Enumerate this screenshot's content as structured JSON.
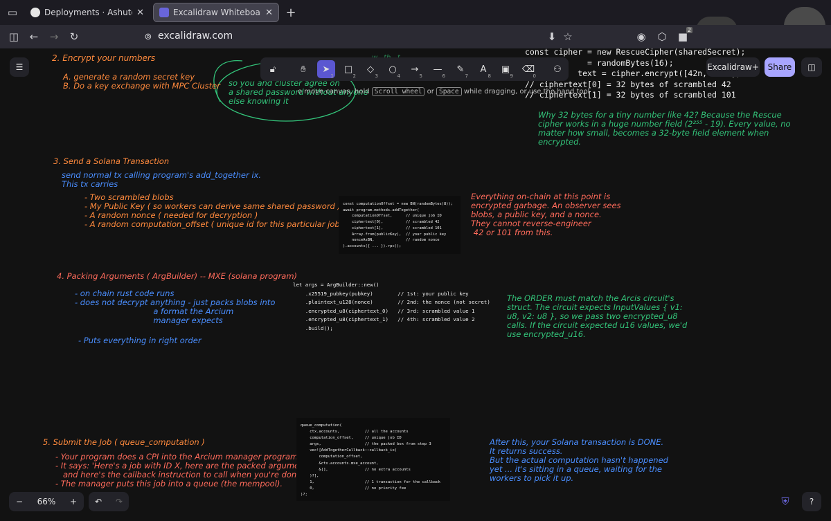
{
  "tabs": [
    {
      "label": "Deployments · Ashutoshx7/Portf",
      "icon": "github-icon"
    },
    {
      "label": "Excalidraw Whiteboard",
      "icon": "excalidraw-icon"
    }
  ],
  "nav": {
    "url": "excalidraw.com",
    "extension_badge": "2"
  },
  "toolbar": {
    "tools": [
      {
        "name": "lock",
        "key": ""
      },
      {
        "name": "hand",
        "key": ""
      },
      {
        "name": "selection",
        "key": "1"
      },
      {
        "name": "rectangle",
        "key": "2"
      },
      {
        "name": "diamond",
        "key": "3"
      },
      {
        "name": "ellipse",
        "key": "4"
      },
      {
        "name": "arrow",
        "key": "5"
      },
      {
        "name": "line",
        "key": "6"
      },
      {
        "name": "draw",
        "key": "7"
      },
      {
        "name": "text",
        "key": "8"
      },
      {
        "name": "image",
        "key": "9"
      },
      {
        "name": "eraser",
        "key": "0"
      },
      {
        "name": "more-tools",
        "key": ""
      }
    ],
    "hint_a": "o move canvas, hold",
    "hint_key1": "Scroll wheel",
    "hint_or": "or",
    "hint_key2": "Space",
    "hint_b": "while dragging, or use the hand tool"
  },
  "top_right": {
    "plus_label": "Excalidraw+",
    "share_label": "Share"
  },
  "zoom": {
    "value": "66%",
    "minus": "−",
    "plus": "+"
  },
  "canvas": {
    "s2_title": "2. Encrypt your numbers",
    "s2_a": "A. generate a random secret key",
    "s2_b": "B. Do a key exchange with MPC Cluster",
    "s2_cut": "w...th...t.  ...  ...   .........  .....",
    "s2_green": "so you and cluster agree on\na shared password without anyone\nelse knowing it",
    "code_top": "const cipher = new RescueCipher(sharedSecret);\n             = randomBytes(16);\n           text = cipher.encrypt([42n, 101n],\n// ciphertext[0] = 32 bytes of scrambled 42\n// ciphertext[1] = 32 bytes of scrambled 101",
    "note_green": "Why 32 bytes for a tiny number like 42? Because the Rescue\ncipher works in a huge number field (2²⁵⁵ - 19). Every value, no\nmatter how small, becomes a 32-byte field element when\nencrypted.",
    "s3_title": "3. Send a Solana Transaction",
    "s3_lines": "send normal tx calling program's add_together ix.\nThis tx carries",
    "s3_list": "- Two scrambled blobs\n- My Public Key ( so workers can derive same shared password ).\n- A random nonce ( needed for decryption )\n- A random computation_offset ( unique id for this particular job )",
    "code_s3": "const computationOffset = new BN(randomBytes(8));\nawait program.methods.addTogether(\n    computationOffset,      // unique job ID\n    ciphertext[0],          // scrambled 42\n    ciphertext[1],          // scrambled 101\n    Array.from(publicKey),  // your public key\n    nonceAsBN,              // random nonce\n).accounts({ ... }).rpc();",
    "note_red": "Everything on-chain at this point is\nencrypted garbage. An observer sees\nblobs, a public key, and a nonce.\nThey cannot reverse-engineer\n 42 or 101 from this.",
    "s4_title": "4. Packing Arguments ( ArgBuilder) -- MXE (solana program)",
    "s4_lines": "- on chain rust code runs\n- does not decrypt anything - just packs blobs into\n                               a format the Arcium\n                               manager expects",
    "s4_last": "- Puts everything in right order",
    "code_s4": "let args = ArgBuilder::new()\n    .x25519_pubkey(pubkey)        // 1st: your public key\n    .plaintext_u128(nonce)        // 2nd: the nonce (not secret)\n    .encrypted_u8(ciphertext_0)   // 3rd: scrambled value 1\n    .encrypted_u8(ciphertext_1)   // 4th: scrambled value 2\n    .build();",
    "note_green2": "The ORDER must match the Arcis circuit's\nstruct. The circuit expects InputValues { v1:\nu8, v2: u8 }, so we pass two encrypted_u8\ncalls. If the circuit expected u16 values, we'd\nuse encrypted_u16.",
    "s5_title": "5. Submit the Job ( queue_computation )",
    "s5_lines": "- Your program does a CPI into the Arcium manager program.\n- It says: 'Here's a job with ID X, here are the packed arguments,\n   and here's the callback instruction to call when you're done.'\n- The manager puts this job into a queue (the mempool).",
    "code_s5": "queue_computation(\n    ctx.accounts,           // all the accounts\n    computation_offset,     // unique job ID\n    args,                   // the packed box from step 3\n    vec![AddTogetherCallback::callback_ix(\n        computation_offset,\n        &ctx.accounts.mxe_account,\n        &[],                // no extra accounts\n    )?],\n    1,                      // 1 transaction for the callback\n    0,                      // no priority fee\n)?;",
    "note_blue": "After this, your Solana transaction is DONE.\nIt returns success.\nBut the actual computation hasn't happened\nyet ... it's sitting in a queue, waiting for the\nworkers to pick it up."
  }
}
